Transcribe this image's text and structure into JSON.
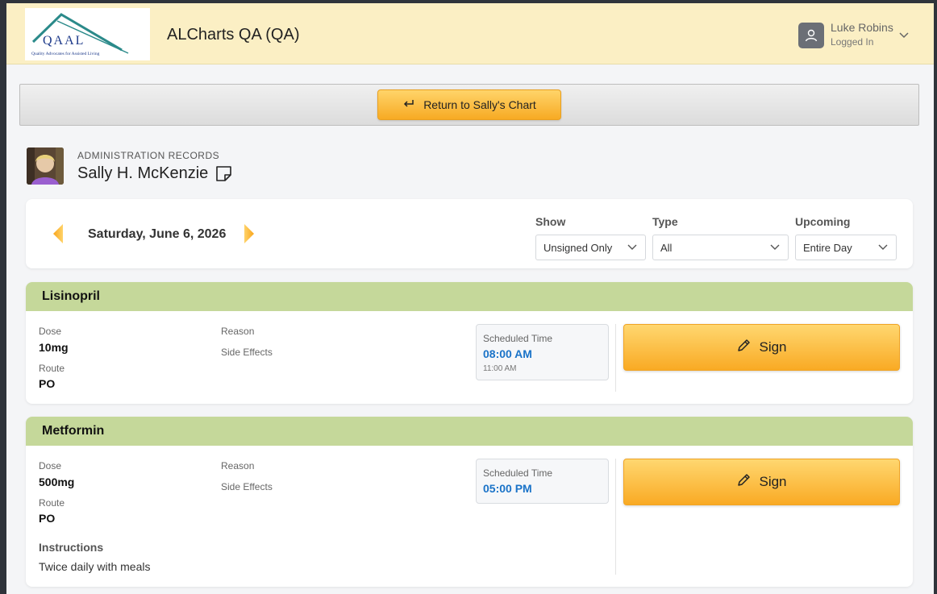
{
  "header": {
    "logo_text": "QAAL",
    "logo_tagline": "Quality Advocates for Assisted Living",
    "app_title": "ALCharts QA (QA)",
    "user_name": "Luke Robins",
    "user_status": "Logged In"
  },
  "return_bar": {
    "button_label": "Return to Sally's Chart"
  },
  "patient": {
    "section_label": "ADMINISTRATION RECORDS",
    "name": "Sally H. McKenzie"
  },
  "filters": {
    "date": "Saturday, June 6, 2026",
    "show": {
      "label": "Show",
      "value": "Unsigned Only"
    },
    "type": {
      "label": "Type",
      "value": "All"
    },
    "upcoming": {
      "label": "Upcoming",
      "value": "Entire Day"
    }
  },
  "medications": [
    {
      "name": "Lisinopril",
      "dose_label": "Dose",
      "dose": "10mg",
      "route_label": "Route",
      "route": "PO",
      "reason_label": "Reason",
      "side_effects_label": "Side Effects",
      "scheduled_label": "Scheduled Time",
      "scheduled_time": "08:00 AM",
      "scheduled_sub": "11:00 AM",
      "sign_label": "Sign"
    },
    {
      "name": "Metformin",
      "dose_label": "Dose",
      "dose": "500mg",
      "route_label": "Route",
      "route": "PO",
      "reason_label": "Reason",
      "side_effects_label": "Side Effects",
      "scheduled_label": "Scheduled Time",
      "scheduled_time": "05:00 PM",
      "instructions_label": "Instructions",
      "instructions": "Twice daily with meals",
      "sign_label": "Sign"
    }
  ],
  "colors": {
    "header_bg": "#fbefc4",
    "accent_orange": "#f9aa24",
    "med_header_green": "#c5d89a",
    "time_blue": "#1a73c8"
  },
  "icons": {
    "user": "user-icon",
    "chevron": "chevron-down-icon",
    "return": "return-arrow-icon",
    "note": "sticky-note-icon",
    "prev": "arrow-left-icon",
    "next": "arrow-right-icon",
    "sign": "pencil-icon"
  }
}
